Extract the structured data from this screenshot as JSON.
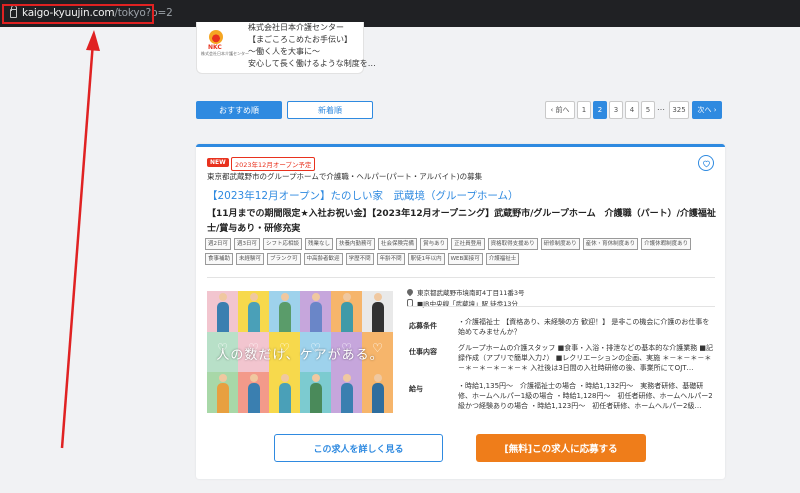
{
  "browser": {
    "url_host": "kaigo-kyuujin.com",
    "url_path": "/tokyo?p=2"
  },
  "company_card": {
    "name": "株式会社日本介護センター",
    "logo_abbr": "NKC",
    "logo_sub": "株式会社日本介護センター",
    "lines": [
      "【まごころこめたお手伝い】",
      "〜働く人を大事に〜",
      "安心して長く働けるような制度を…"
    ]
  },
  "sort": {
    "recommended": "おすすめ順",
    "newest": "新着順"
  },
  "pagination": {
    "prev": "前へ",
    "pages": [
      "1",
      "2",
      "3",
      "4",
      "5"
    ],
    "current": "2",
    "ellipsis": "…",
    "last": "325",
    "next": "次へ"
  },
  "job": {
    "badge_new": "NEW",
    "badge_open": "2023年12月オープン予定",
    "subtitle": "東京都武蔵野市のグループホームで介護職・ヘルパー(パート・アルバイト)の募集",
    "title": "【2023年12月オープン】たのしい家　武蔵境（グループホーム）",
    "headline": "【11月までの期間限定★入社お祝い金】【2023年12月オープニング】武蔵野市/グループホーム　介護職（パート）/介護福祉士/賞与あり・研修充実",
    "tags": [
      "週2日可",
      "週3日可",
      "シフト応相談",
      "残業なし",
      "扶養内勤務可",
      "社会保険完備",
      "賞与あり",
      "正社員登用",
      "資格取得支援あり",
      "研修制度あり",
      "産休・育休制度あり",
      "介護休暇制度あり",
      "食事補助",
      "未経験可",
      "ブランク可",
      "中高齢者歓迎",
      "学歴不問",
      "年齢不問",
      "駅徒1年以内",
      "WEB面接可",
      "介護福祉士"
    ],
    "address": "東京都武蔵野市境南町4丁目11番3号",
    "access": "■JR中央線「武蔵境」駅 徒歩13分",
    "photo_caption": "人の数だけ、ケアがある。",
    "conditions_label": "応募条件",
    "conditions": "・介護福祉士 【資格あり、未経験の方 歓迎！】 是非この機会に介護のお仕事を始めてみませんか？",
    "work_label": "仕事内容",
    "work": "グループホームの介護スタッフ ■食事・入浴・排泄などの基本的な介護業務 ■記録作成（アプリで簡単入力♪） ■レクリエーションの企画、実施 ＊－＊－＊－＊－＊－＊－＊－＊－＊ 入社後は3日間の入社時研修の後、事業所にてOJT…",
    "salary_label": "給与",
    "salary": "・時給1,135円～　介護福祉士の場合 ・時給1,132円～　実務者研修、基礎研修、ホームヘルパー1級の場合 ・時給1,128円～　初任者研修、ホームヘルパー2級かつ経験ありの場合 ・時給1,123円～　初任者研修、ホームヘルパー2級…",
    "detail_button": "この求人を詳しく見る",
    "apply_button": "[無料]この求人に応募する"
  },
  "colors": {
    "accent": "#2f8ae0",
    "apply": "#ef7d1a",
    "new_badge": "#e8321e",
    "annotation": "#e02222"
  }
}
